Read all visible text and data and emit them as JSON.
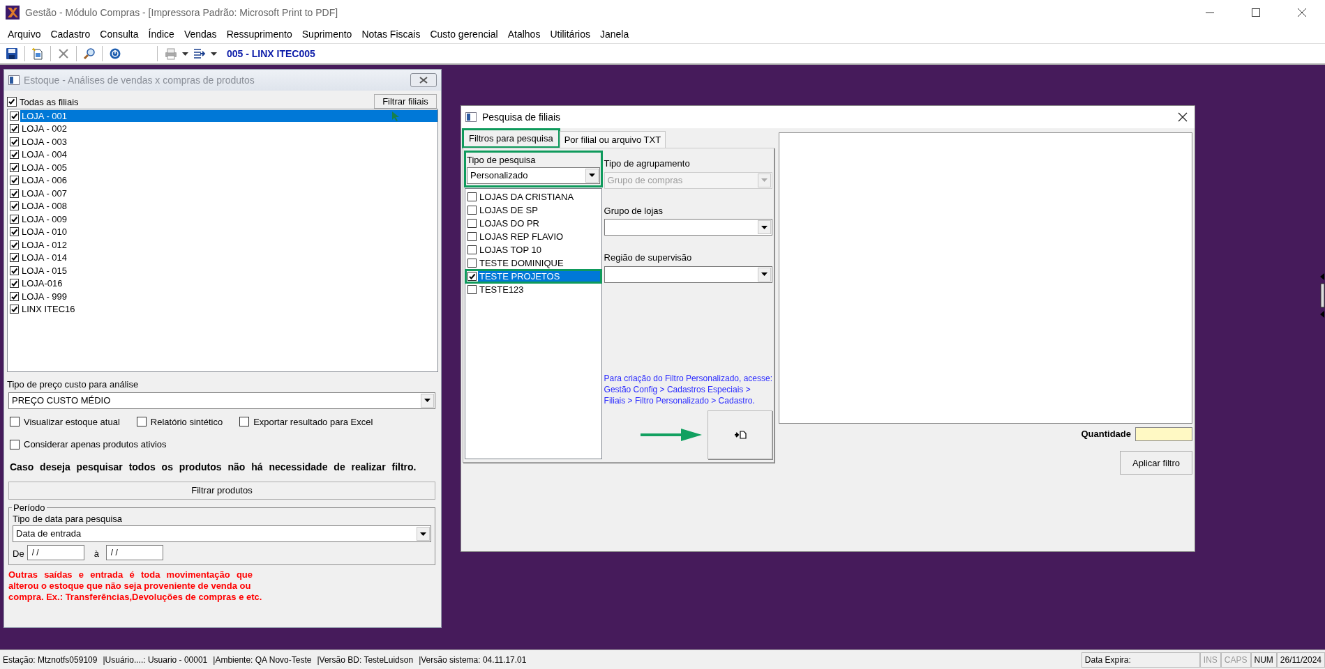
{
  "window": {
    "title": "Gestão  - Módulo Compras - [Impressora Padrão: Microsoft Print to PDF]"
  },
  "menu": [
    "Arquivo",
    "Cadastro",
    "Consulta",
    "Índice",
    "Vendas",
    "Ressuprimento",
    "Suprimento",
    "Notas Fiscais",
    "Custo gerencial",
    "Atalhos",
    "Utilitários",
    "Janela"
  ],
  "toolbar": {
    "label": "005 - LINX ITEC005"
  },
  "stock_window": {
    "title": "Estoque - Análises de vendas x compras de produtos",
    "all_branches": {
      "label": "Todas as filiais",
      "checked": true
    },
    "filter_branches_button": "Filtrar filiais",
    "branches": [
      {
        "label": "LOJA - 001",
        "checked": true,
        "selected": true
      },
      {
        "label": "LOJA - 002",
        "checked": true,
        "selected": false
      },
      {
        "label": "LOJA - 003",
        "checked": true,
        "selected": false
      },
      {
        "label": "LOJA - 004",
        "checked": true,
        "selected": false
      },
      {
        "label": "LOJA - 005",
        "checked": true,
        "selected": false
      },
      {
        "label": "LOJA - 006",
        "checked": true,
        "selected": false
      },
      {
        "label": "LOJA - 007",
        "checked": true,
        "selected": false
      },
      {
        "label": "LOJA - 008",
        "checked": true,
        "selected": false
      },
      {
        "label": "LOJA - 009",
        "checked": true,
        "selected": false
      },
      {
        "label": "LOJA - 010",
        "checked": true,
        "selected": false
      },
      {
        "label": "LOJA - 012",
        "checked": true,
        "selected": false
      },
      {
        "label": "LOJA - 014",
        "checked": true,
        "selected": false
      },
      {
        "label": "LOJA - 015",
        "checked": true,
        "selected": false
      },
      {
        "label": "LOJA-016",
        "checked": true,
        "selected": false
      },
      {
        "label": "LOJA - 999",
        "checked": true,
        "selected": false
      },
      {
        "label": "LINX ITEC16",
        "checked": true,
        "selected": false
      }
    ],
    "cost_type": {
      "label": "Tipo de preço custo para análise",
      "value": "PREÇO CUSTO MÉDIO"
    },
    "options": [
      {
        "label": "Visualizar estoque atual",
        "checked": false
      },
      {
        "label": "Relatório sintético",
        "checked": false
      },
      {
        "label": "Exportar resultado para Excel",
        "checked": false
      },
      {
        "label": "Considerar apenas produtos ativios",
        "checked": false
      }
    ],
    "notice": "Caso deseja pesquisar todos os produtos não há necessidade de realizar filtro.",
    "filter_products_button": "Filtrar produtos",
    "period": {
      "legend": "Período",
      "date_type_label": "Tipo de data para pesquisa",
      "date_type_value": "Data de entrada",
      "from_label": "De",
      "from_value": "/ /",
      "to_label": "à",
      "to_value": "/ /"
    },
    "warning_lines": [
      "Outras saídas e entrada é toda movimentação que",
      "alterou o estoque que não seja proveniente de venda ou",
      "compra. Ex.: Transferências,Devoluções de compras e etc."
    ]
  },
  "search_dialog": {
    "title": "Pesquisa de filiais",
    "tabs": [
      {
        "label": "Filtros para pesquisa",
        "selected": true,
        "highlighted": true
      },
      {
        "label": "Por filial ou arquivo TXT",
        "selected": false,
        "highlighted": false
      }
    ],
    "search_type": {
      "label": "Tipo de pesquisa",
      "value": "Personalizado",
      "highlighted": true
    },
    "groups": [
      {
        "label": "LOJAS DA CRISTIANA",
        "checked": false,
        "selected": false,
        "highlighted": false
      },
      {
        "label": "LOJAS DE SP",
        "checked": false,
        "selected": false,
        "highlighted": false
      },
      {
        "label": "LOJAS DO PR",
        "checked": false,
        "selected": false,
        "highlighted": false
      },
      {
        "label": "LOJAS REP FLAVIO",
        "checked": false,
        "selected": false,
        "highlighted": false
      },
      {
        "label": "LOJAS TOP 10",
        "checked": false,
        "selected": false,
        "highlighted": false
      },
      {
        "label": "TESTE DOMINIQUE",
        "checked": false,
        "selected": false,
        "highlighted": false
      },
      {
        "label": "TESTE PROJETOS",
        "checked": true,
        "selected": true,
        "highlighted": true
      },
      {
        "label": "TESTE123",
        "checked": false,
        "selected": false,
        "highlighted": false
      }
    ],
    "selects": [
      {
        "label": "Tipo de agrupamento",
        "value": "Grupo de compras",
        "disabled": true
      },
      {
        "label": "Grupo de lojas",
        "disabled": false
      },
      {
        "label": "Região de supervisão",
        "disabled": false
      }
    ],
    "help_lines": [
      "Para criação do Filtro Personalizado, acesse:",
      "Gestão Config > Cadastros Especiais >",
      "Filiais > Filtro Personalizado > Cadastro."
    ],
    "quantity_label": "Quantidade",
    "apply_button": "Aplicar filtro"
  },
  "status_bar": [
    {
      "text": "Estação: Mtznotfs059109",
      "kind": "info"
    },
    {
      "text": "|Usuário....: Usuario - 00001",
      "kind": "info"
    },
    {
      "text": "|Ambiente: QA Novo-Teste",
      "kind": "info"
    },
    {
      "text": "|Versão BD: TesteLuidson",
      "kind": "info"
    },
    {
      "text": "|Versão sistema: 04.11.17.01",
      "kind": "info"
    },
    {
      "text": "Data Expira:",
      "kind": "panel"
    },
    {
      "text": "INS",
      "kind": "key",
      "active": false
    },
    {
      "text": "CAPS",
      "kind": "key",
      "active": false
    },
    {
      "text": "NUM",
      "kind": "key",
      "active": true
    },
    {
      "text": "26/11/2024",
      "kind": "panel"
    }
  ]
}
